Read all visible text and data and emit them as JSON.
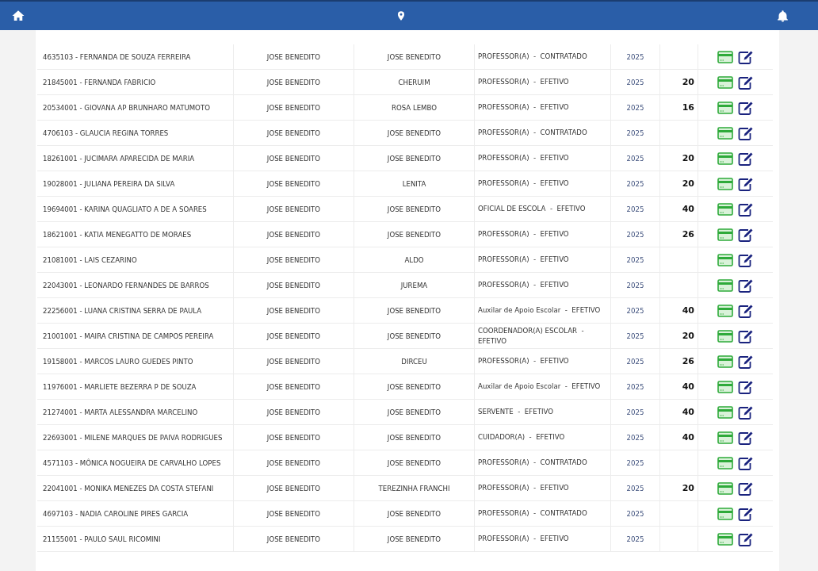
{
  "rows": [
    {
      "name": "4635103 - FERNANDA DE SOUZA FERREIRA",
      "col_2": "JOSE BENEDITO",
      "col_3": "JOSE BENEDITO",
      "role": "PROFESSOR(A)  -  CONTRATADO",
      "year": "2025"
    },
    {
      "name": "21845001 - FERNANDA FABRICIO",
      "col_2": "JOSE BENEDITO",
      "col_3": "CHERUIM",
      "role": "PROFESSOR(A)  -  EFETIVO",
      "year": "2025",
      "hours": "20"
    },
    {
      "name": "20534001 - GIOVANA AP BRUNHARO MATUMOTO",
      "col_2": "JOSE BENEDITO",
      "col_3": "ROSA LEMBO",
      "role": "PROFESSOR(A)  -  EFETIVO",
      "year": "2025",
      "hours": "16"
    },
    {
      "name": "4706103 - GLAUCIA REGINA TORRES",
      "col_2": "JOSE BENEDITO",
      "col_3": "JOSE BENEDITO",
      "role": "PROFESSOR(A)  -  CONTRATADO",
      "year": "2025"
    },
    {
      "name": "18261001 - JUCIMARA APARECIDA DE MARIA",
      "col_2": "JOSE BENEDITO",
      "col_3": "JOSE BENEDITO",
      "role": "PROFESSOR(A)  -  EFETIVO",
      "year": "2025",
      "hours": "20"
    },
    {
      "name": "19028001 - JULIANA PEREIRA DA SILVA",
      "col_2": "JOSE BENEDITO",
      "col_3": "LENITA",
      "role": "PROFESSOR(A)  -  EFETIVO",
      "year": "2025",
      "hours": "20"
    },
    {
      "name": "19694001 - KARINA QUAGLIATO A DE A SOARES",
      "col_2": "JOSE BENEDITO",
      "col_3": "JOSE BENEDITO",
      "role": "OFICIAL DE ESCOLA  -  EFETIVO",
      "year": "2025",
      "hours": "40"
    },
    {
      "name": "18621001 - KATIA MENEGATTO DE MORAES",
      "col_2": "JOSE BENEDITO",
      "col_3": "JOSE BENEDITO",
      "role": "PROFESSOR(A)  -  EFETIVO",
      "year": "2025",
      "hours": "26"
    },
    {
      "name": "21081001 - LAIS CEZARINO",
      "col_2": "JOSE BENEDITO",
      "col_3": "ALDO",
      "role": "PROFESSOR(A)  -  EFETIVO",
      "year": "2025"
    },
    {
      "name": "22043001 - LEONARDO FERNANDES DE BARROS",
      "col_2": "JOSE BENEDITO",
      "col_3": "JUREMA",
      "role": "PROFESSOR(A)  -  EFETIVO",
      "year": "2025"
    },
    {
      "name": "22256001 - LUANA CRISTINA SERRA DE PAULA",
      "col_2": "JOSE BENEDITO",
      "col_3": "JOSE BENEDITO",
      "role": "Auxilar de Apoio Escolar  -  EFETIVO",
      "year": "2025",
      "hours": "40"
    },
    {
      "name": "21001001 - MAIRA CRISTINA DE CAMPOS PEREIRA",
      "col_2": "JOSE BENEDITO",
      "col_3": "JOSE BENEDITO",
      "role": "COORDENADOR(A) ESCOLAR  -  EFETIVO",
      "year": "2025",
      "hours": "20"
    },
    {
      "name": "19158001 - MARCOS LAURO GUEDES PINTO",
      "col_2": "JOSE BENEDITO",
      "col_3": "DIRCEU",
      "role": "PROFESSOR(A)  -  EFETIVO",
      "year": "2025",
      "hours": "26"
    },
    {
      "name": "11976001 - MARLIETE BEZERRA P DE SOUZA",
      "col_2": "JOSE BENEDITO",
      "col_3": "JOSE BENEDITO",
      "role": "Auxilar de Apoio Escolar  -  EFETIVO",
      "year": "2025",
      "hours": "40"
    },
    {
      "name": "21274001 - MARTA ALESSANDRA MARCELINO",
      "col_2": "JOSE BENEDITO",
      "col_3": "JOSE BENEDITO",
      "role": "SERVENTE  -  EFETIVO",
      "year": "2025",
      "hours": "40"
    },
    {
      "name": "22693001 - MILENE MARQUES DE PAIVA RODRIGUES",
      "col_2": "JOSE BENEDITO",
      "col_3": "JOSE BENEDITO",
      "role": "CUIDADOR(A)  -  EFETIVO",
      "year": "2025",
      "hours": "40"
    },
    {
      "name": "4571103 - MÔNICA NOGUEIRA DE CARVALHO LOPES",
      "col_2": "JOSE BENEDITO",
      "col_3": "JOSE BENEDITO",
      "role": "PROFESSOR(A)  -  CONTRATADO",
      "year": "2025"
    },
    {
      "name": "22041001 - MONIKA MENEZES DA COSTA STEFANI",
      "col_2": "JOSE BENEDITO",
      "col_3": "TEREZINHA FRANCHI",
      "role": "PROFESSOR(A)  -  EFETIVO",
      "year": "2025",
      "hours": "20"
    },
    {
      "name": "4697103 - NADIA CAROLINE PIRES GARCIA",
      "col_2": "JOSE BENEDITO",
      "col_3": "JOSE BENEDITO",
      "role": "PROFESSOR(A)  -  CONTRATADO",
      "year": "2025"
    },
    {
      "name": "21155001 - PAULO SAUL RICOMINI",
      "col_2": "JOSE BENEDITO",
      "col_3": "JOSE BENEDITO",
      "role": "PROFESSOR(A)  -  EFETIVO",
      "year": "2025"
    }
  ]
}
